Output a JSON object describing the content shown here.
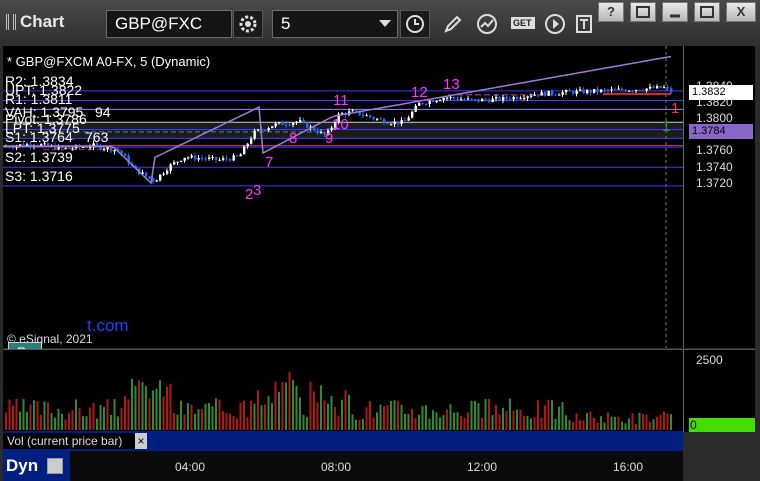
{
  "app": {
    "title": "Chart"
  },
  "toolbar": {
    "symbol": "GBP@FXC",
    "interval": "5",
    "get_label": "GET"
  },
  "window_buttons": [
    "?",
    "",
    "",
    "X"
  ],
  "chart": {
    "header": "* GBP@FXCM A0-FX, 5 (Dynamic)",
    "copyright": "© eSignal, 2021",
    "ghost_text": "t.com",
    "pc_label": "Pc",
    "levels": [
      {
        "label": "R2: 1.3834",
        "price": 1.3834,
        "color": "#3b3bff"
      },
      {
        "label": "UPT: 1.3822",
        "price": 1.3822,
        "color": "#3b3bff"
      },
      {
        "label": "R1: 1.3811",
        "price": 1.3811,
        "color": "#8a8aff"
      },
      {
        "label": "VAH: 1.3795",
        "price": 1.3795,
        "color": "#cccccc",
        "suffix": "94"
      },
      {
        "label": "Pivot: 1.3786",
        "price": 1.3786,
        "color": "#3b3bff"
      },
      {
        "label": "LPT: 1.3775",
        "price": 1.3775,
        "color": "#3b3bff"
      },
      {
        "label": "S1: 1.3764",
        "price": 1.3764,
        "color": "#3b3bff",
        "suffix": "763"
      },
      {
        "label": "S2: 1.3739",
        "price": 1.3739,
        "color": "#3b3bff"
      },
      {
        "label": "S3: 1.3716",
        "price": 1.3716,
        "color": "#3b3bff"
      }
    ],
    "y_ticks": [
      "1.3840",
      "1.3820",
      "1.3800",
      "1.3780",
      "1.3760",
      "1.3740",
      "1.3720"
    ],
    "y_tick_values": [
      1.384,
      1.382,
      1.38,
      1.378,
      1.376,
      1.374,
      1.372
    ],
    "price_tags": [
      {
        "text": "1.3832",
        "price": 1.3832,
        "bg": "#ffffff",
        "color": "#000000"
      },
      {
        "text": "1.3784",
        "price": 1.3784,
        "bg": "#8a66c8",
        "color": "#000000"
      }
    ],
    "annotations": [
      "2",
      "3",
      "7",
      "8",
      "9",
      "10",
      "11",
      "12",
      "13",
      "1",
      "1"
    ],
    "volume": {
      "ticks": [
        "2500",
        "0"
      ],
      "label": "Vol (current price bar)"
    },
    "x_ticks": [
      "04:00",
      "08:00",
      "12:00",
      "16:00"
    ]
  },
  "colors": {
    "bull": "#ffffff",
    "bear": "#1e6bff",
    "vol_up": "#2e8b2e",
    "vol_down": "#b01818",
    "ma": "#9a7fd1"
  }
}
